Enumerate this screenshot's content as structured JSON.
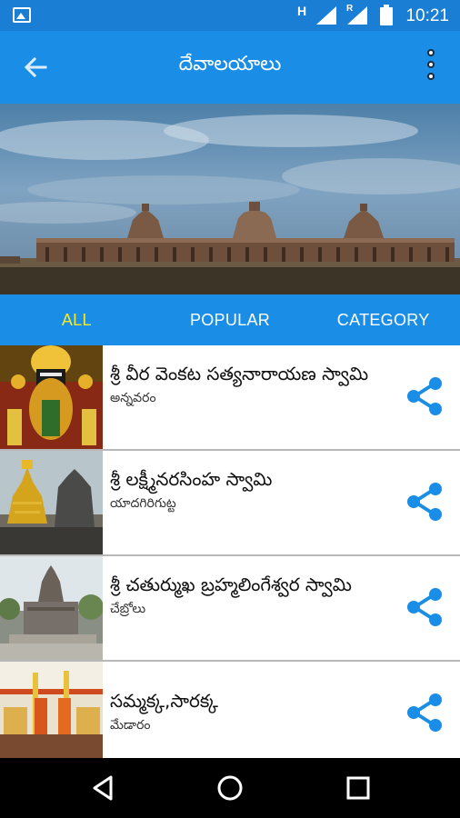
{
  "status_bar": {
    "time": "10:21",
    "network_label_1": "H",
    "network_label_2": "R",
    "icons": [
      "gallery-icon",
      "signal-icon",
      "roaming-signal-icon",
      "battery-icon"
    ]
  },
  "app_bar": {
    "title": "దేవాలయాలు",
    "icons": [
      "back-arrow-icon",
      "more-vert-icon"
    ]
  },
  "hero": {
    "icon": "temple-banner-image"
  },
  "tabs": [
    {
      "label": "ALL",
      "active": true
    },
    {
      "label": "POPULAR",
      "active": false
    },
    {
      "label": "CATEGORY",
      "active": false
    }
  ],
  "colors": {
    "status_bar": "#1a7fd4",
    "app_bar": "#1a8ee6",
    "active_tab": "#f5ea2a",
    "share_icon": "#1a8ee6"
  },
  "temples": [
    {
      "name": "శ్రీ వీర వెంకట సత్యనారాయణ స్వామి",
      "place": "అన్నవరం",
      "thumb": "satyanarayana-deity-image"
    },
    {
      "name": "శ్రీ లక్ష్మీనరసింహ స్వామి",
      "place": "యాదగిరిగుట్ట",
      "thumb": "golden-gopuram-image"
    },
    {
      "name": "శ్రీ చతుర్ముఖ బ్రహ్మలింగేశ్వర స్వామి",
      "place": "చేబ్రోలు",
      "thumb": "stone-temple-image"
    },
    {
      "name": "సమ్మక్క,సారక్క",
      "place": "మేడారం",
      "thumb": "festival-shrine-image"
    }
  ],
  "nav_bar": {
    "icons": [
      "nav-back-icon",
      "nav-home-icon",
      "nav-recents-icon"
    ]
  }
}
